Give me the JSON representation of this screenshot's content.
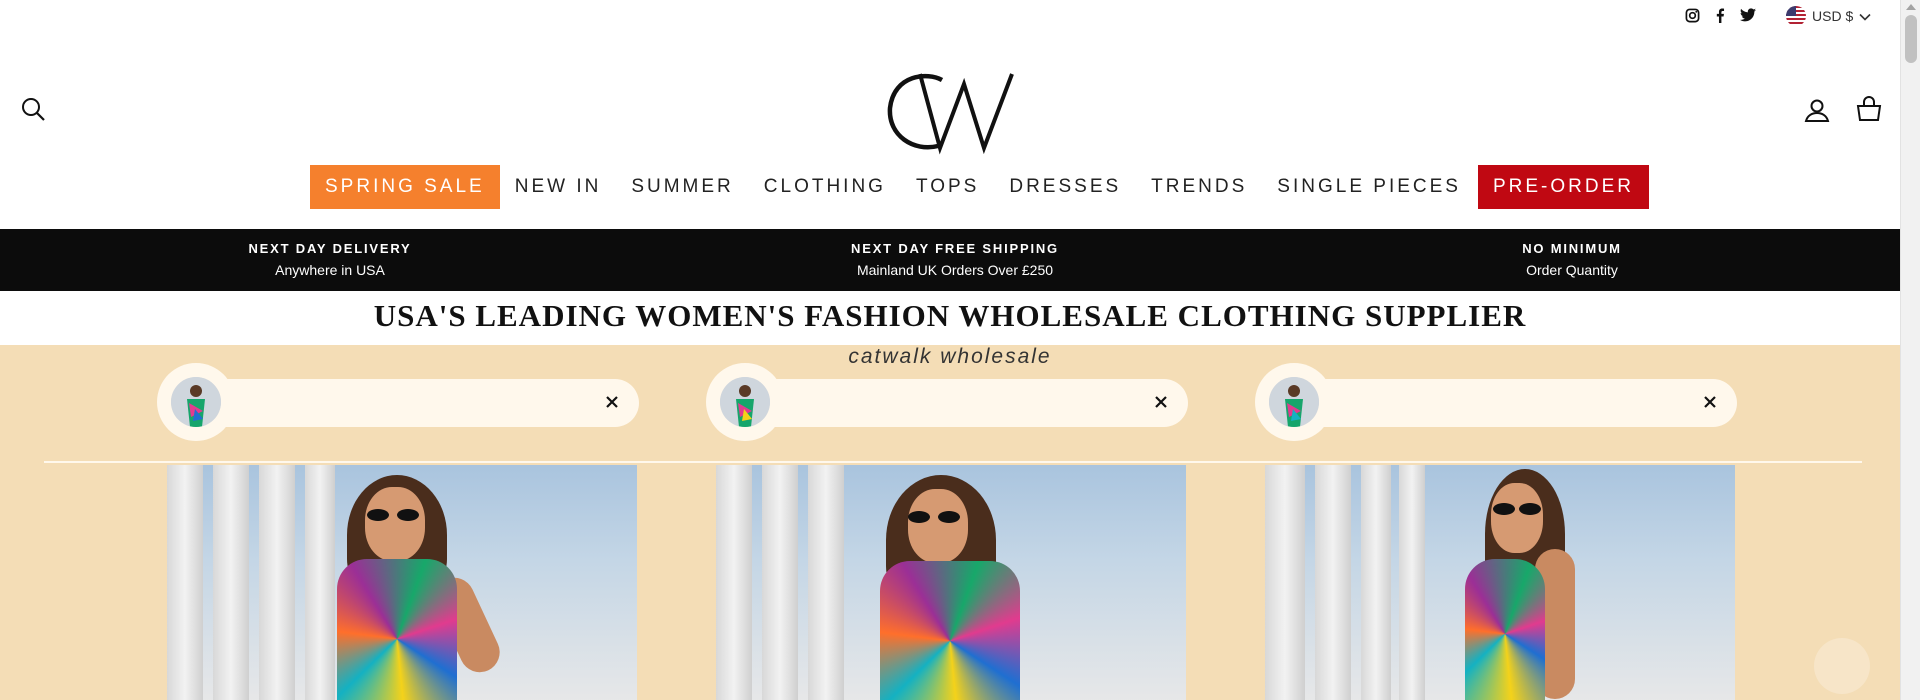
{
  "topbar": {
    "social_icons": [
      "instagram-icon",
      "facebook-icon",
      "twitter-icon"
    ],
    "currency": {
      "flag": "us-flag-icon",
      "label": "USD $"
    }
  },
  "header": {
    "logo_text": "CW",
    "left_icon": "search-icon",
    "right_icons": [
      "account-icon",
      "cart-icon"
    ]
  },
  "nav": {
    "items": [
      {
        "label": "SPRING SALE",
        "style": "sale"
      },
      {
        "label": "NEW IN",
        "style": ""
      },
      {
        "label": "SUMMER",
        "style": ""
      },
      {
        "label": "CLOTHING",
        "style": ""
      },
      {
        "label": "TOPS",
        "style": ""
      },
      {
        "label": "DRESSES",
        "style": ""
      },
      {
        "label": "TRENDS",
        "style": ""
      },
      {
        "label": "SINGLE PIECES",
        "style": ""
      },
      {
        "label": "PRE-ORDER",
        "style": "preorder"
      }
    ],
    "colors": {
      "sale": "#f5802d",
      "preorder": "#c00812"
    }
  },
  "announcement": {
    "items": [
      {
        "title": "NEXT DAY DELIVERY",
        "subtitle": "Anywhere in USA"
      },
      {
        "title": "NEXT DAY FREE SHIPPING",
        "subtitle": "Mainland UK Orders Over £250"
      },
      {
        "title": "NO MINIMUM",
        "subtitle": "Order Quantity"
      }
    ]
  },
  "headline": "USA'S LEADING WOMEN'S FASHION WHOLESALE CLOTHING SUPPLIER",
  "hero": {
    "brand": "catwalk wholesale",
    "background": "#f4ddb6",
    "stories": [
      {
        "close_icon": "close-icon"
      },
      {
        "close_icon": "close-icon"
      },
      {
        "close_icon": "close-icon"
      }
    ]
  }
}
